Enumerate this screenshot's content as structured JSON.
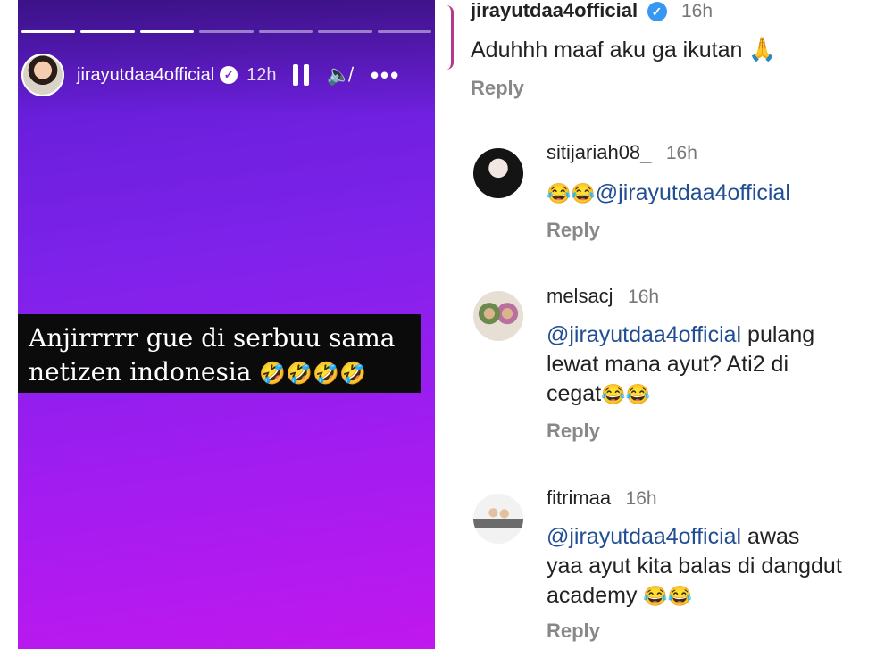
{
  "story": {
    "username": "jirayutdaa4official",
    "time": "12h",
    "caption_line1": "Anjirrrrr gue di serbuu sama",
    "caption_line2": "netizen indonesia",
    "caption_emoji": "🤣🤣🤣🤣",
    "progress": {
      "total_segments": 7,
      "completed_segments": 3
    },
    "icons": [
      "pause-icon",
      "mute-icon",
      "more-icon",
      "verified-icon"
    ]
  },
  "comments": [
    {
      "author": "jirayutdaa4official",
      "verified": true,
      "time": "16h",
      "text": "Aduhhh maaf aku ga ikutan 🙏",
      "reply_label": "Reply"
    },
    {
      "author": "sitijariah08_",
      "time": "16h",
      "emoji": "😂😂",
      "mention": "@jirayutdaa4official",
      "reply_label": "Reply"
    },
    {
      "author": "melsacj",
      "time": "16h",
      "mention": "@jirayutdaa4official",
      "text_a": "pulang",
      "text_b": "lewat mana ayut? Ati2 di",
      "text_c": "cegat",
      "emoji": "😂😂",
      "reply_label": "Reply"
    },
    {
      "author": "fitrimaa",
      "time": "16h",
      "mention": "@jirayutdaa4official",
      "text_a": "awas",
      "text_b": "yaa ayut kita balas di dangdut",
      "text_c": "academy",
      "emoji": "😂😂",
      "reply_label": "Reply"
    }
  ],
  "colors": {
    "story_gradient_top": "#5a1ccf",
    "story_gradient_bottom": "#c018ee",
    "mention": "#214e92",
    "verified_badge": "#3897f0"
  }
}
